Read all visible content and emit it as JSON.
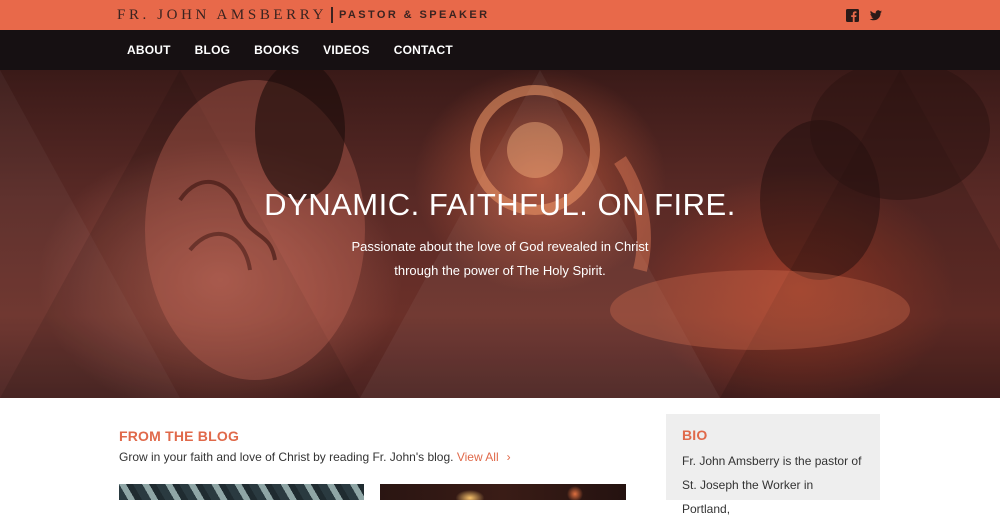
{
  "header": {
    "name": "FR. JOHN AMSBERRY",
    "role": "PASTOR & SPEAKER",
    "social": [
      {
        "icon": "facebook-icon"
      },
      {
        "icon": "twitter-icon"
      }
    ]
  },
  "nav": {
    "items": [
      {
        "label": "ABOUT"
      },
      {
        "label": "BLOG"
      },
      {
        "label": "BOOKS"
      },
      {
        "label": "VIDEOS"
      },
      {
        "label": "CONTACT"
      }
    ]
  },
  "hero": {
    "title": "DYNAMIC. FAITHFUL. ON FIRE.",
    "subtitle": "Passionate about the love of God revealed in Christ through the power of The Holy Spirit."
  },
  "blog": {
    "title": "FROM THE BLOG",
    "description": "Grow in your faith and love of Christ by reading Fr. John's blog.",
    "view_all": "View All",
    "arrow": "›"
  },
  "bio": {
    "title": "BIO",
    "text": "Fr. John Amsberry is the pastor of St. Joseph the Worker in Portland,"
  },
  "colors": {
    "accent": "#e8694a",
    "nav_background": "#161012",
    "bio_background": "#eeeeee"
  }
}
